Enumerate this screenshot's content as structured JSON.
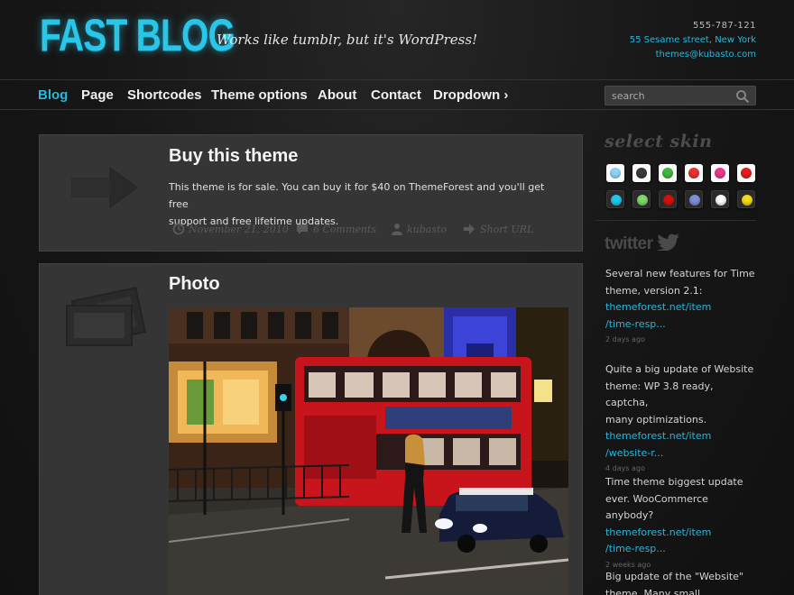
{
  "header": {
    "logo": "FAST BLOG",
    "tagline": "Works like tumblr, but it's WordPress!",
    "phone": "555-787-121",
    "address": "55 Sesame street, New York",
    "email": "themes@kubasto.com"
  },
  "nav": {
    "items": [
      "Blog",
      "Page",
      "Shortcodes",
      "Theme options",
      "About",
      "Contact",
      "Dropdown ›"
    ],
    "active": "Blog",
    "search_placeholder": "search"
  },
  "posts": [
    {
      "title": "Buy this theme",
      "body_line1": "This theme is for sale. You can buy it for $40 on ThemeForest and you'll get free",
      "body_line2": "support and free lifetime updates.",
      "date": "November 21, 2010",
      "comments": "6 Comments",
      "author": "kubasto",
      "short_url": "Short URL",
      "icon": "arrow-right-icon"
    },
    {
      "title": "Photo",
      "icon": "photo-icon"
    }
  ],
  "sidebar": {
    "skin_heading": "select skin",
    "skins_row1": [
      "#8fd3f7",
      "#3a3a3a",
      "#3fb93f",
      "#e8312d",
      "#e83a8a",
      "#e01e1e"
    ],
    "skins_row2": [
      "#20c8f0",
      "#7fd86a",
      "#d40f0f",
      "#7f8fd8",
      "#ffffff",
      "#f5dc14"
    ],
    "twitter_heading": "twitter",
    "tweets": [
      {
        "text1": "Several new features for Time",
        "text2": "theme, version 2.1:",
        "link1": "themeforest.net/item",
        "link2": "/time-resp...",
        "date": "2 days ago"
      },
      {
        "text1": "Quite a big update of Website",
        "text2": "theme: WP 3.8 ready, captcha,",
        "text3": "many optimizations.",
        "link1": "themeforest.net/item",
        "link2": "/website-r...",
        "date": "4 days ago"
      },
      {
        "text1": "Time theme biggest update",
        "text2": "ever. WooCommerce anybody?",
        "link1": "themeforest.net/item",
        "link2": "/time-resp...",
        "date": "2 weeks ago"
      },
      {
        "text1": "Big update of the \"Website\"",
        "text2": "theme. Many small"
      }
    ]
  }
}
